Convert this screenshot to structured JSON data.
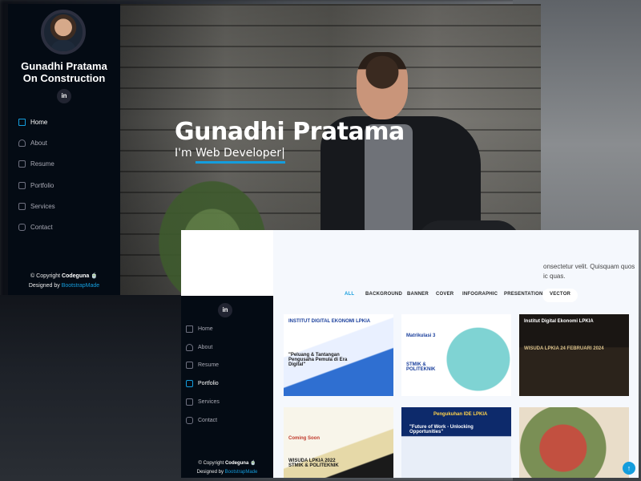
{
  "profile": {
    "name_line1": "Gunadhi Pratama",
    "name_line2": "On Construction",
    "social_icon": "linkedin-icon",
    "social_label": "in"
  },
  "nav": {
    "items": [
      {
        "label": "Home",
        "icon": "home-icon"
      },
      {
        "label": "About",
        "icon": "user-icon"
      },
      {
        "label": "Resume",
        "icon": "file-icon"
      },
      {
        "label": "Portfolio",
        "icon": "book-icon"
      },
      {
        "label": "Services",
        "icon": "server-icon"
      },
      {
        "label": "Contact",
        "icon": "envelope-icon"
      }
    ],
    "active_window1": "Home",
    "active_window2": "Portfolio"
  },
  "footer": {
    "copyright_prefix": "© Copyright",
    "brand": "Codeguna",
    "emoji": "🍵",
    "designed_prefix": "Designed by",
    "designer": "BootstrapMade"
  },
  "hero": {
    "title": "Gunadhi Pratama",
    "subtitle_prefix": "I'm",
    "subtitle_typed": "Web Developer",
    "cursor": "|"
  },
  "portfolio": {
    "intro_line1": "onsectetur velit. Quisquam quos",
    "intro_line2": "ic quas.",
    "filters": [
      "ALL",
      "BACKGROUND",
      "BANNER",
      "COVER",
      "INFOGRAPHIC",
      "PRESENTATION",
      "VECTOR"
    ],
    "active_filter": "ALL",
    "items": [
      {
        "caption": "INSTITUT DIGITAL EKONOMI LPKIA",
        "headline": "\"Peluang & Tantangan Pengusaha Pemula di Era Digital\""
      },
      {
        "caption": "Matrikulasi 3",
        "headline": "STMIK & POLITEKNIK"
      },
      {
        "caption": "Institut Digital Ekonomi LPKIA",
        "headline": "WISUDA LPKIA 24 FEBRUARI 2024"
      },
      {
        "caption": "Coming Soon",
        "headline": "WISUDA LPKIA 2022 STMIK & POLITEKNIK"
      },
      {
        "caption": "Pengukuhan IDE LPKIA",
        "headline": "\"Future of Work - Unlocking Opportunities\""
      },
      {
        "caption": "",
        "headline": ""
      }
    ]
  },
  "colors": {
    "accent": "#149ddd",
    "sidebar_bg": "#040b14",
    "nav_text": "#a8a9b4"
  }
}
